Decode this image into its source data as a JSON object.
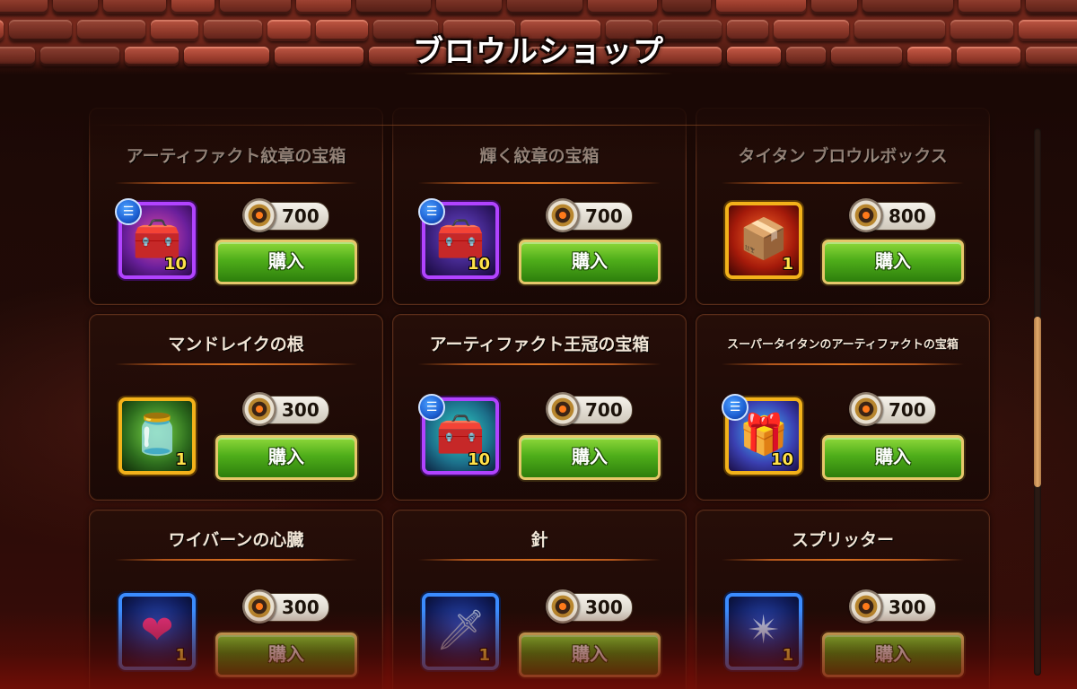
{
  "shop": {
    "title": "ブロウルショップ"
  },
  "buy_label": "購入",
  "items": [
    {
      "name": "アーティファクト紋章の宝箱",
      "price": "700",
      "qty": "10",
      "icon": "artifact-emblem-chest-icon",
      "has_info": true
    },
    {
      "name": "輝く紋章の宝箱",
      "price": "700",
      "qty": "10",
      "icon": "shining-emblem-chest-icon",
      "has_info": true
    },
    {
      "name": "タイタン ブロウルボックス",
      "price": "800",
      "qty": "1",
      "icon": "titan-brawl-box-icon",
      "has_info": false
    },
    {
      "name": "マンドレイクの根",
      "price": "300",
      "qty": "1",
      "icon": "mandrake-root-icon",
      "has_info": false
    },
    {
      "name": "アーティファクト王冠の宝箱",
      "price": "700",
      "qty": "10",
      "icon": "artifact-crown-chest-icon",
      "has_info": true
    },
    {
      "name": "スーパータイタンのアーティファクトの宝箱",
      "price": "700",
      "qty": "10",
      "icon": "super-titan-artifact-chest-icon",
      "has_info": true
    },
    {
      "name": "ワイバーンの心臓",
      "price": "300",
      "qty": "1",
      "icon": "wyvern-heart-icon",
      "has_info": false
    },
    {
      "name": "針",
      "price": "300",
      "qty": "1",
      "icon": "needle-icon",
      "has_info": false
    },
    {
      "name": "スプリッター",
      "price": "300",
      "qty": "1",
      "icon": "splitter-icon",
      "has_info": false
    }
  ],
  "colors": {
    "buy_button": "#4fae1a",
    "title_text": "#ffffff",
    "divider": "#d97020"
  }
}
